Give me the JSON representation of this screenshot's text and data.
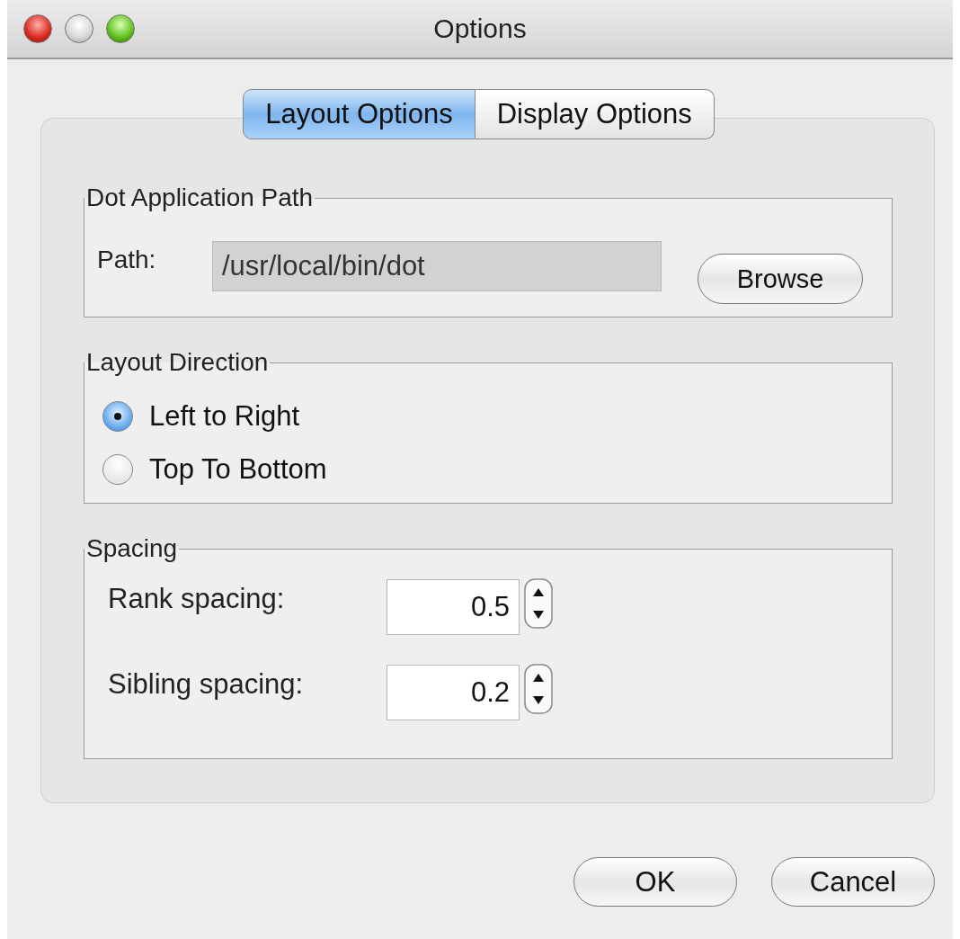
{
  "window": {
    "title": "Options"
  },
  "tabs": [
    {
      "label": "Layout Options",
      "selected": true
    },
    {
      "label": "Display Options",
      "selected": false
    }
  ],
  "dot_path": {
    "title": "Dot Application Path",
    "label": "Path:",
    "value": "/usr/local/bin/dot",
    "disabled": true,
    "button": "Browse"
  },
  "layout_direction": {
    "title": "Layout Direction",
    "options": [
      {
        "label": "Left to Right",
        "selected": true
      },
      {
        "label": "Top To Bottom",
        "selected": false
      }
    ]
  },
  "spacing": {
    "title": "Spacing",
    "fields": [
      {
        "label": "Rank spacing:",
        "value": "0.5"
      },
      {
        "label": "Sibling spacing:",
        "value": "0.2"
      }
    ]
  },
  "buttons": [
    "OK",
    "Cancel"
  ]
}
